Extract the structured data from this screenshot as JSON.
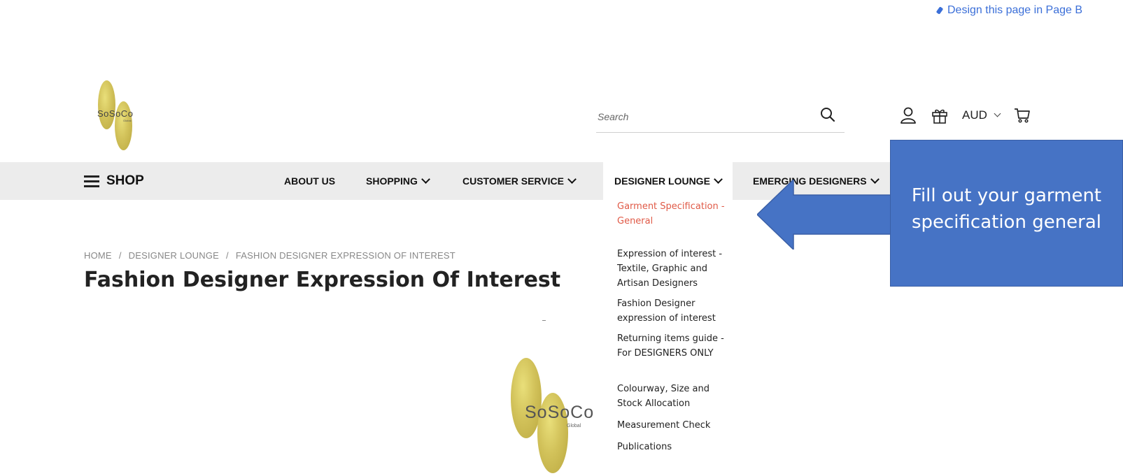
{
  "top_link": {
    "label": "Design this page in Page B"
  },
  "header": {
    "logo_text": "SoSoCo",
    "logo_sub": "Global",
    "search_placeholder": "Search",
    "currency": "AUD"
  },
  "nav": {
    "shop": "SHOP",
    "items": [
      {
        "label": "ABOUT US",
        "has_menu": false
      },
      {
        "label": "SHOPPING",
        "has_menu": true
      },
      {
        "label": "CUSTOMER SERVICE",
        "has_menu": true
      },
      {
        "label": "DESIGNER LOUNGE",
        "has_menu": true
      },
      {
        "label": "EMERGING DESIGNERS",
        "has_menu": true
      }
    ]
  },
  "dropdown": {
    "items": [
      {
        "label": "Garment Specification - General",
        "active": true
      },
      {
        "label": "Expression of interest - Textile, Graphic and Artisan Designers"
      },
      {
        "label": "Fashion Designer expression of interest"
      },
      {
        "label": "Returning items guide - For DESIGNERS ONLY"
      },
      {
        "label": "Colourway, Size and Stock Allocation"
      },
      {
        "label": "Measurement Check"
      },
      {
        "label": "Publications"
      }
    ]
  },
  "breadcrumb": {
    "items": [
      "HOME",
      "DESIGNER LOUNGE",
      "FASHION DESIGNER EXPRESSION OF INTEREST"
    ],
    "separator": "/"
  },
  "page": {
    "title": "Fashion Designer Expression Of Interest"
  },
  "annotation": {
    "text_line1": "Fill out your garment",
    "text_line2": "specification general",
    "color": "#4673c5"
  },
  "colors": {
    "nav_bg": "#ececec",
    "active_link": "#e05a47",
    "link_blue": "#3b6fd8",
    "logo_gold": "#d2c25a"
  }
}
